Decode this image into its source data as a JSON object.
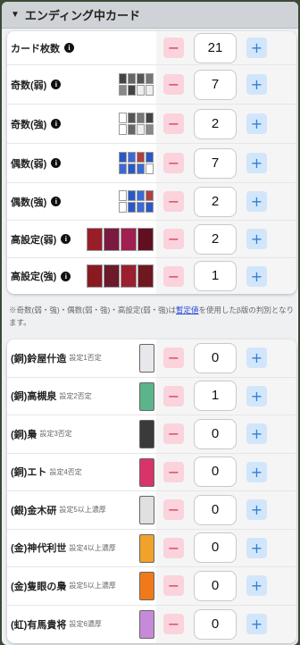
{
  "header": {
    "title": "エンディング中カード"
  },
  "top_rows": [
    {
      "label": "カード枚数",
      "value": "21",
      "thumbs": "none"
    },
    {
      "label": "奇数(弱)",
      "value": "7",
      "thumbs": "grid8"
    },
    {
      "label": "奇数(強)",
      "value": "2",
      "thumbs": "grid5"
    },
    {
      "label": "偶数(弱)",
      "value": "7",
      "thumbs": "blue8"
    },
    {
      "label": "偶数(強)",
      "value": "2",
      "thumbs": "blue5"
    },
    {
      "label": "高設定(弱)",
      "value": "2",
      "thumbs": "red4"
    },
    {
      "label": "高設定(強)",
      "value": "1",
      "thumbs": "red4b"
    }
  ],
  "note": {
    "before": "※奇数(弱・強)・偶数(弱・強)・高設定(弱・強)は",
    "link": "暫定値",
    "after": "を使用したβ版の判別となります。"
  },
  "bottom_rows": [
    {
      "label": "(銅)鈴屋什造",
      "sub": "設定1否定",
      "value": "0",
      "color": "#e8e8ec"
    },
    {
      "label": "(銅)高槻泉",
      "sub": "設定2否定",
      "value": "1",
      "color": "#5bb48a"
    },
    {
      "label": "(銅)梟",
      "sub": "設定3否定",
      "value": "0",
      "color": "#3a3a3a"
    },
    {
      "label": "(銅)エト",
      "sub": "設定4否定",
      "value": "0",
      "color": "#d8346a"
    },
    {
      "label": "(銀)金木研",
      "sub": "設定5以上濃厚",
      "value": "0",
      "color": "#e0e0e0"
    },
    {
      "label": "(金)神代利世",
      "sub": "設定4以上濃厚",
      "value": "0",
      "color": "#f0a22a"
    },
    {
      "label": "(金)隻眼の梟",
      "sub": "設定5以上濃厚",
      "value": "0",
      "color": "#f07a1a"
    },
    {
      "label": "(虹)有馬貴将",
      "sub": "設定6濃厚",
      "value": "0",
      "color": "#c58ad8"
    }
  ],
  "buttons": {
    "minus": "−",
    "plus": "+"
  },
  "info_icon": "i"
}
